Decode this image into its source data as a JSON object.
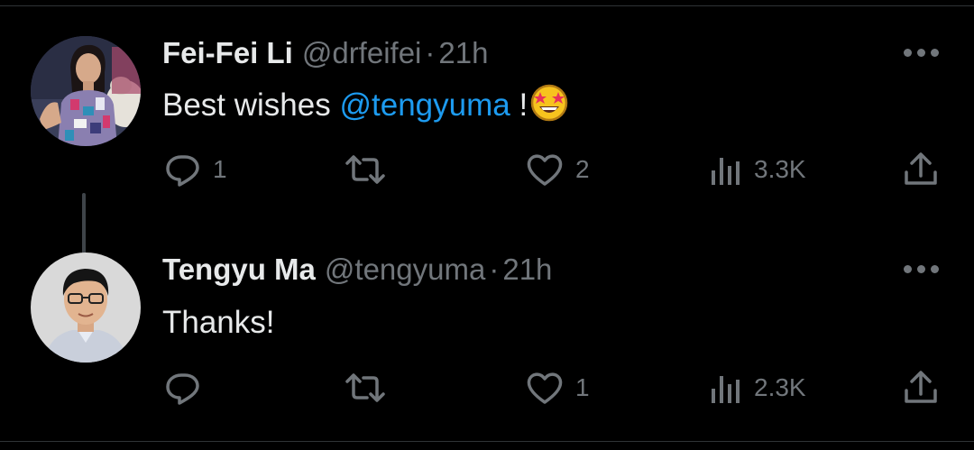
{
  "tweets": [
    {
      "name": "Fei-Fei Li",
      "handle": "@drfeifei",
      "separator": "·",
      "time": "21h",
      "text_before": "Best wishes ",
      "mention": "@tengyuma",
      "text_after": " !",
      "emoji": "star-struck-emoji",
      "actions": {
        "replies": "1",
        "retweets": "",
        "likes": "2",
        "views": "3.3K"
      }
    },
    {
      "name": "Tengyu Ma",
      "handle": "@tengyuma",
      "separator": "·",
      "time": "21h",
      "text_before": "Thanks!",
      "mention": "",
      "text_after": "",
      "actions": {
        "replies": "",
        "retweets": "",
        "likes": "1",
        "views": "2.3K"
      }
    }
  ],
  "icons": {
    "reply": "reply-icon",
    "retweet": "retweet-icon",
    "like": "heart-icon",
    "views": "views-icon",
    "share": "share-icon",
    "more": "more-icon"
  },
  "colors": {
    "background": "#000000",
    "text": "#e7e9ea",
    "muted": "#71767b",
    "link": "#1d9bf0"
  }
}
